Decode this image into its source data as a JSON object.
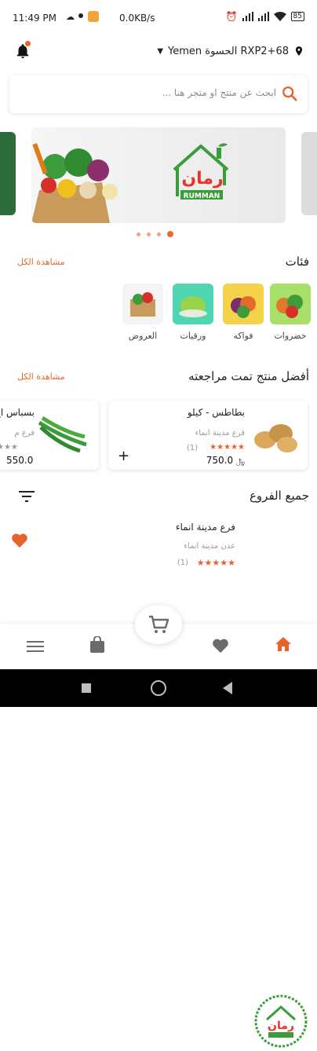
{
  "status": {
    "time": "11:49 PM",
    "speed": "0.0KB/s",
    "battery": "85"
  },
  "header": {
    "location": "Yemen الحسوة RXP2+68"
  },
  "search": {
    "placeholder": "ابحث عن منتج او متجر هنا ..."
  },
  "banner": {
    "logo_ar": "رمان",
    "logo_en": "RUMMAN"
  },
  "categories": {
    "title": "فئات",
    "see_all": "مشاهدة الكل",
    "items": [
      {
        "label": "خضروات"
      },
      {
        "label": "فواكه"
      },
      {
        "label": "ورقيات"
      },
      {
        "label": "العروض"
      }
    ]
  },
  "top_products": {
    "title": "أفضل منتج تمت مراجعته",
    "see_all": "مشاهدة الكل",
    "products": [
      {
        "name": "بطاطس - كيلو",
        "branch": "فرع مدينة انماء",
        "rating_count": "(1)",
        "price": "750.0",
        "currency": "﷼"
      },
      {
        "name": "بسباس اخ",
        "branch": "فرع م",
        "price": "550.0"
      }
    ]
  },
  "branches": {
    "title": "جميع الفروع",
    "items": [
      {
        "name": "فرع مدينة انماء",
        "address": "عدن مدينة انماء",
        "rating_count": "(1)"
      }
    ]
  },
  "colors": {
    "accent": "#e8622c",
    "green": "#3a9c3a"
  }
}
